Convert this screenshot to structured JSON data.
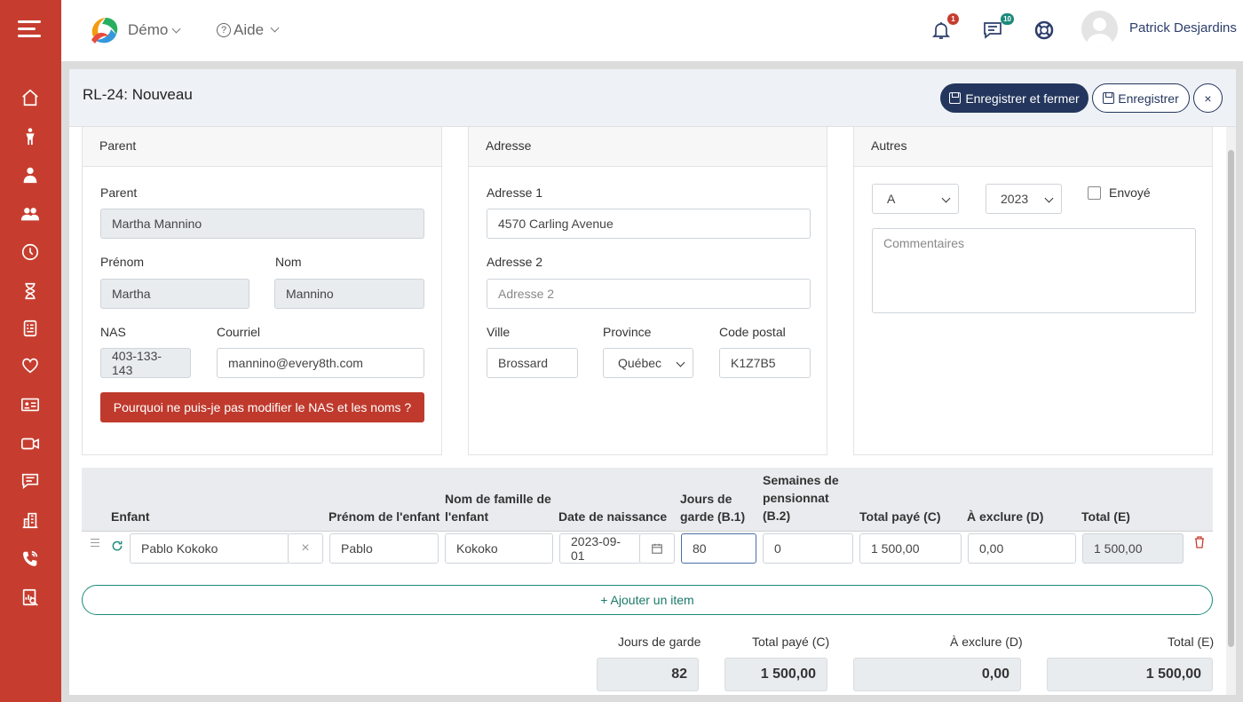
{
  "topbar": {
    "demo": "Démo",
    "aide": "Aide",
    "notif_count": "1",
    "messages_count": "10",
    "username": "Patrick Desjardins"
  },
  "sidebar_icons": [
    "home-icon",
    "child-icon",
    "staff-icon",
    "group-icon",
    "clock-icon",
    "hourglass-icon",
    "document-icon",
    "heart-icon",
    "id-card-icon",
    "video-icon",
    "chat-icon",
    "building-icon",
    "phone-icon",
    "report-icon"
  ],
  "modal": {
    "title": "RL-24: Nouveau",
    "save_close": "Enregistrer et fermer",
    "save": "Enregistrer",
    "close": "×"
  },
  "parent": {
    "header": "Parent",
    "parent_label": "Parent",
    "parent_value": "Martha Mannino",
    "prenom_label": "Prénom",
    "prenom_value": "Martha",
    "nom_label": "Nom",
    "nom_value": "Mannino",
    "nas_label": "NAS",
    "nas_value": "403-133-143",
    "courriel_label": "Courriel",
    "courriel_value": "mannino@every8th.com",
    "why_button": "Pourquoi ne puis-je pas modifier le NAS et les noms ?"
  },
  "adresse": {
    "header": "Adresse",
    "adresse1_label": "Adresse 1",
    "adresse1_value": "4570  Carling Avenue",
    "adresse2_label": "Adresse 2",
    "adresse2_placeholder": "Adresse 2",
    "ville_label": "Ville",
    "ville_value": "Brossard",
    "province_label": "Province",
    "province_value": "Québec",
    "code_label": "Code postal",
    "code_value": "K1Z7B5"
  },
  "autres": {
    "header": "Autres",
    "type_value": "A",
    "year_value": "2023",
    "envoye_label": "Envoyé",
    "commentaires_placeholder": "Commentaires"
  },
  "table": {
    "headers": {
      "enfant": "Enfant",
      "prenom": "Prénom de l'enfant",
      "nom_famille_1": "Nom de famille de",
      "nom_famille_2": "l'enfant",
      "naissance": "Date de naissance",
      "jours_1": "Jours de",
      "jours_2": "garde (B.1)",
      "semaines_1": "Semaines de",
      "semaines_2": "pensionnat",
      "semaines_3": "(B.2)",
      "total_paye": "Total payé (C)",
      "exclure": "À exclure (D)",
      "total": "Total (E)"
    },
    "row": {
      "enfant": "Pablo Kokoko",
      "prenom": "Pablo",
      "nom": "Kokoko",
      "naissance": "2023-09-01",
      "jours": "80",
      "semaines": "0",
      "total_paye": "1 500,00",
      "exclure": "0,00",
      "total": "1 500,00"
    },
    "add_item": "+ Ajouter un item"
  },
  "totals": {
    "jours_label": "Jours de garde",
    "jours_value": "82",
    "total_paye_label": "Total payé (C)",
    "total_paye_value": "1 500,00",
    "exclure_label": "À exclure (D)",
    "exclure_value": "0,00",
    "total_label": "Total (E)",
    "total_value": "1 500,00"
  },
  "colors": {
    "sidebar": "#c63d2f",
    "primary": "#24365d",
    "accent": "#1a8a7a"
  }
}
